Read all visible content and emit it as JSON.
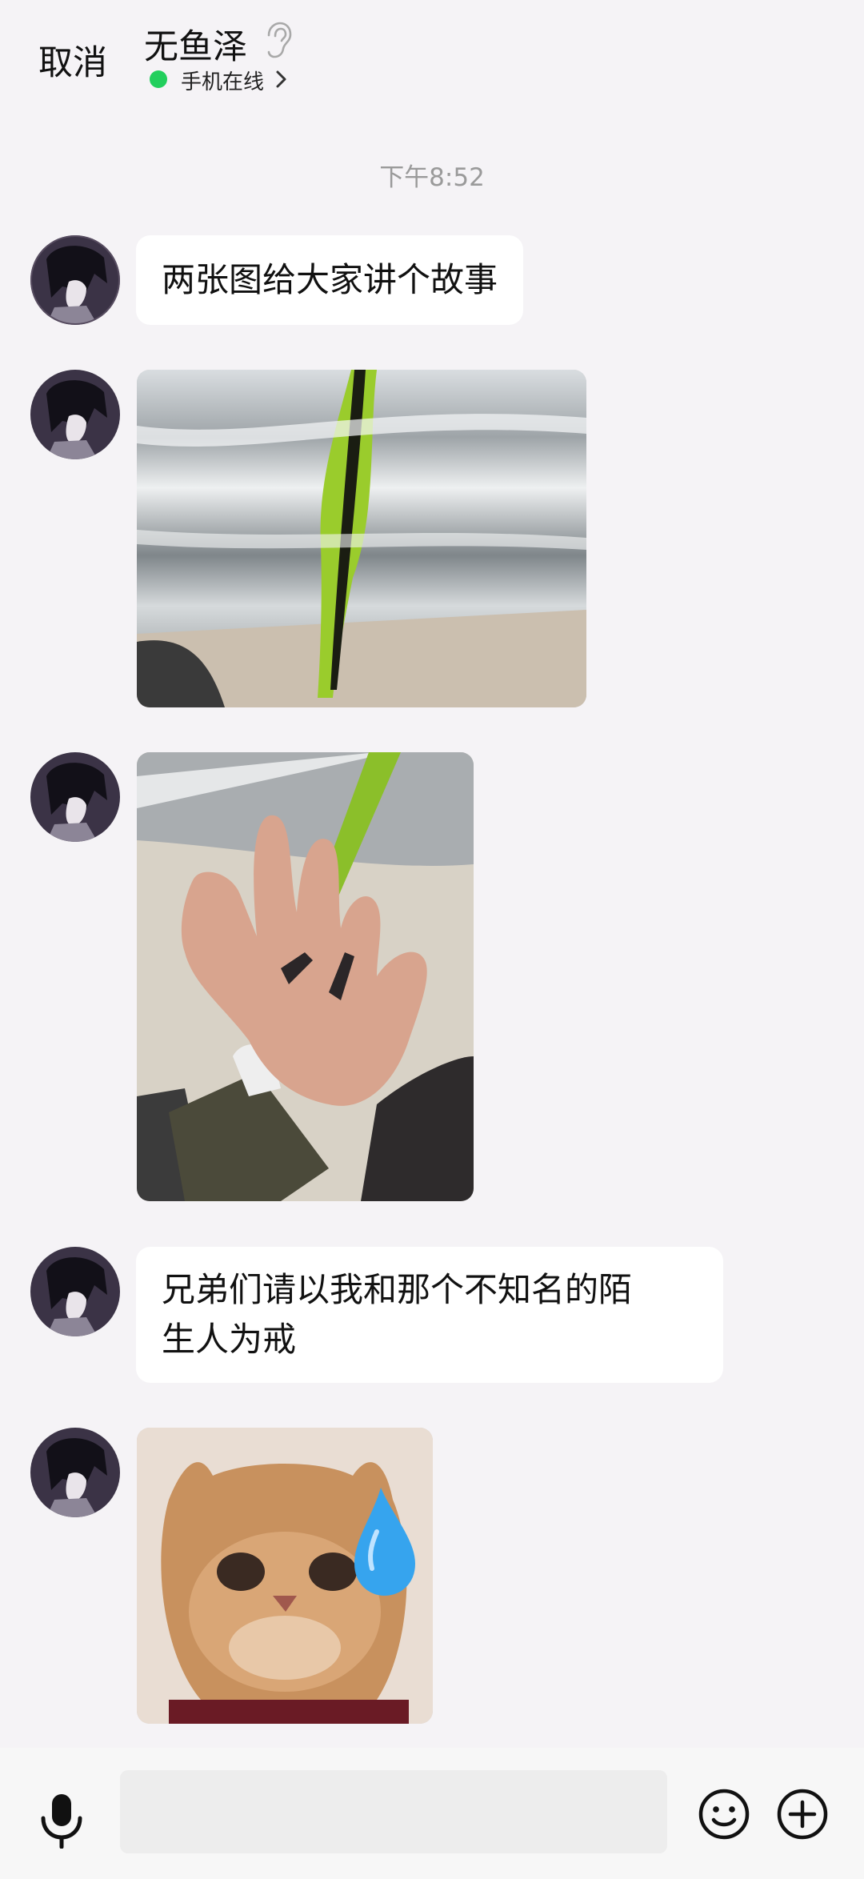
{
  "header": {
    "cancel_label": "取消",
    "contact_name": "无鱼泽",
    "status_text": "手机在线",
    "ear_icon": "ear-icon",
    "chevron_icon": "chevron-right-icon",
    "status_color": "#22cf5d"
  },
  "chat": {
    "timestamp": "下午8:52",
    "messages": [
      {
        "type": "text",
        "lines": [
          "两张图给大家讲个故事"
        ]
      },
      {
        "type": "image",
        "subject": "photo-metal-tube-green-tape"
      },
      {
        "type": "image",
        "subject": "photo-hand-holding-screws"
      },
      {
        "type": "text",
        "lines": [
          "兄弟们请以我和那个不知名的陌",
          "生人为戒"
        ]
      },
      {
        "type": "image",
        "subject": "sticker-cat-sweat-drop"
      }
    ]
  },
  "bottom_bar": {
    "input_value": "",
    "mic_icon": "microphone-icon",
    "emoji_icon": "emoji-icon",
    "plus_icon": "plus-circle-icon"
  },
  "colors": {
    "background": "#f5f3f6",
    "bubble": "#ffffff",
    "timestamp": "#9a9a9a",
    "input_bg": "#ededed"
  }
}
